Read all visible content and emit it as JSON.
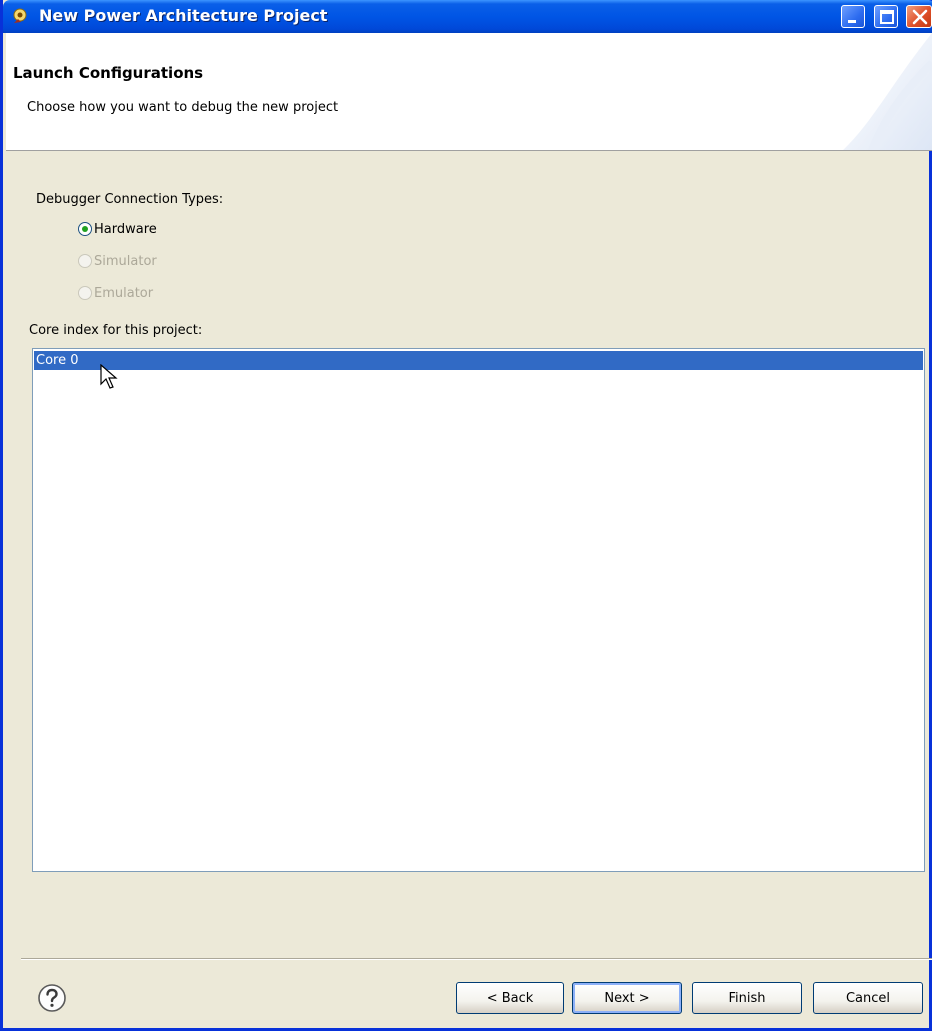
{
  "window": {
    "title": "New Power Architecture Project"
  },
  "header": {
    "title": "Launch Configurations",
    "description": "Choose how you want to debug the new project"
  },
  "debugger": {
    "label": "Debugger Connection Types:",
    "options": [
      {
        "label": "Hardware",
        "checked": true,
        "enabled": true
      },
      {
        "label": "Simulator",
        "checked": false,
        "enabled": false
      },
      {
        "label": "Emulator",
        "checked": false,
        "enabled": false
      }
    ]
  },
  "core": {
    "label": "Core index for this project:",
    "items": [
      "Core 0"
    ],
    "selected": "Core 0"
  },
  "buttons": {
    "back": "< Back",
    "next": "Next >",
    "finish": "Finish",
    "cancel": "Cancel"
  },
  "icons": {
    "app": "eclipse-plugin-icon",
    "help": "help-icon",
    "minimize": "minimize-icon",
    "maximize": "maximize-icon",
    "close": "close-icon"
  },
  "colors": {
    "title_bar": "#0055e5",
    "selection": "#316ac5",
    "dialog_bg": "#ece9d8",
    "radio_checked": "#21a121"
  }
}
